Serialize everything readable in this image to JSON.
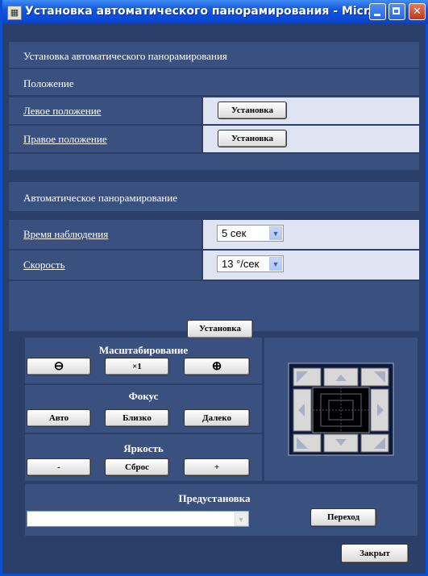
{
  "window": {
    "title": "Установка автоматического панорамирования - Micr..."
  },
  "header": {
    "title": "Установка автоматического панорамирования"
  },
  "position": {
    "section_title": "Положение",
    "left_label": "Левое положение",
    "right_label": "Правое положение",
    "set_label": "Установка"
  },
  "auto_pan": {
    "section_title": "Автоматическое панорамирование",
    "dwell_label": "Время наблюдения",
    "dwell_value": "5 сек",
    "speed_label": "Скорость",
    "speed_value": "13 °/сек",
    "set_label": "Установка"
  },
  "zoom": {
    "title": "Масштабирование",
    "x1_label": "×1"
  },
  "focus": {
    "title": "Фокус",
    "auto": "Авто",
    "near": "Близко",
    "far": "Далеко"
  },
  "brightness": {
    "title": "Яркость",
    "minus": "-",
    "reset": "Сброс",
    "plus": "+"
  },
  "preset": {
    "title": "Предустановка",
    "value": "",
    "go_label": "Переход"
  },
  "close_label": "Закрыт"
}
